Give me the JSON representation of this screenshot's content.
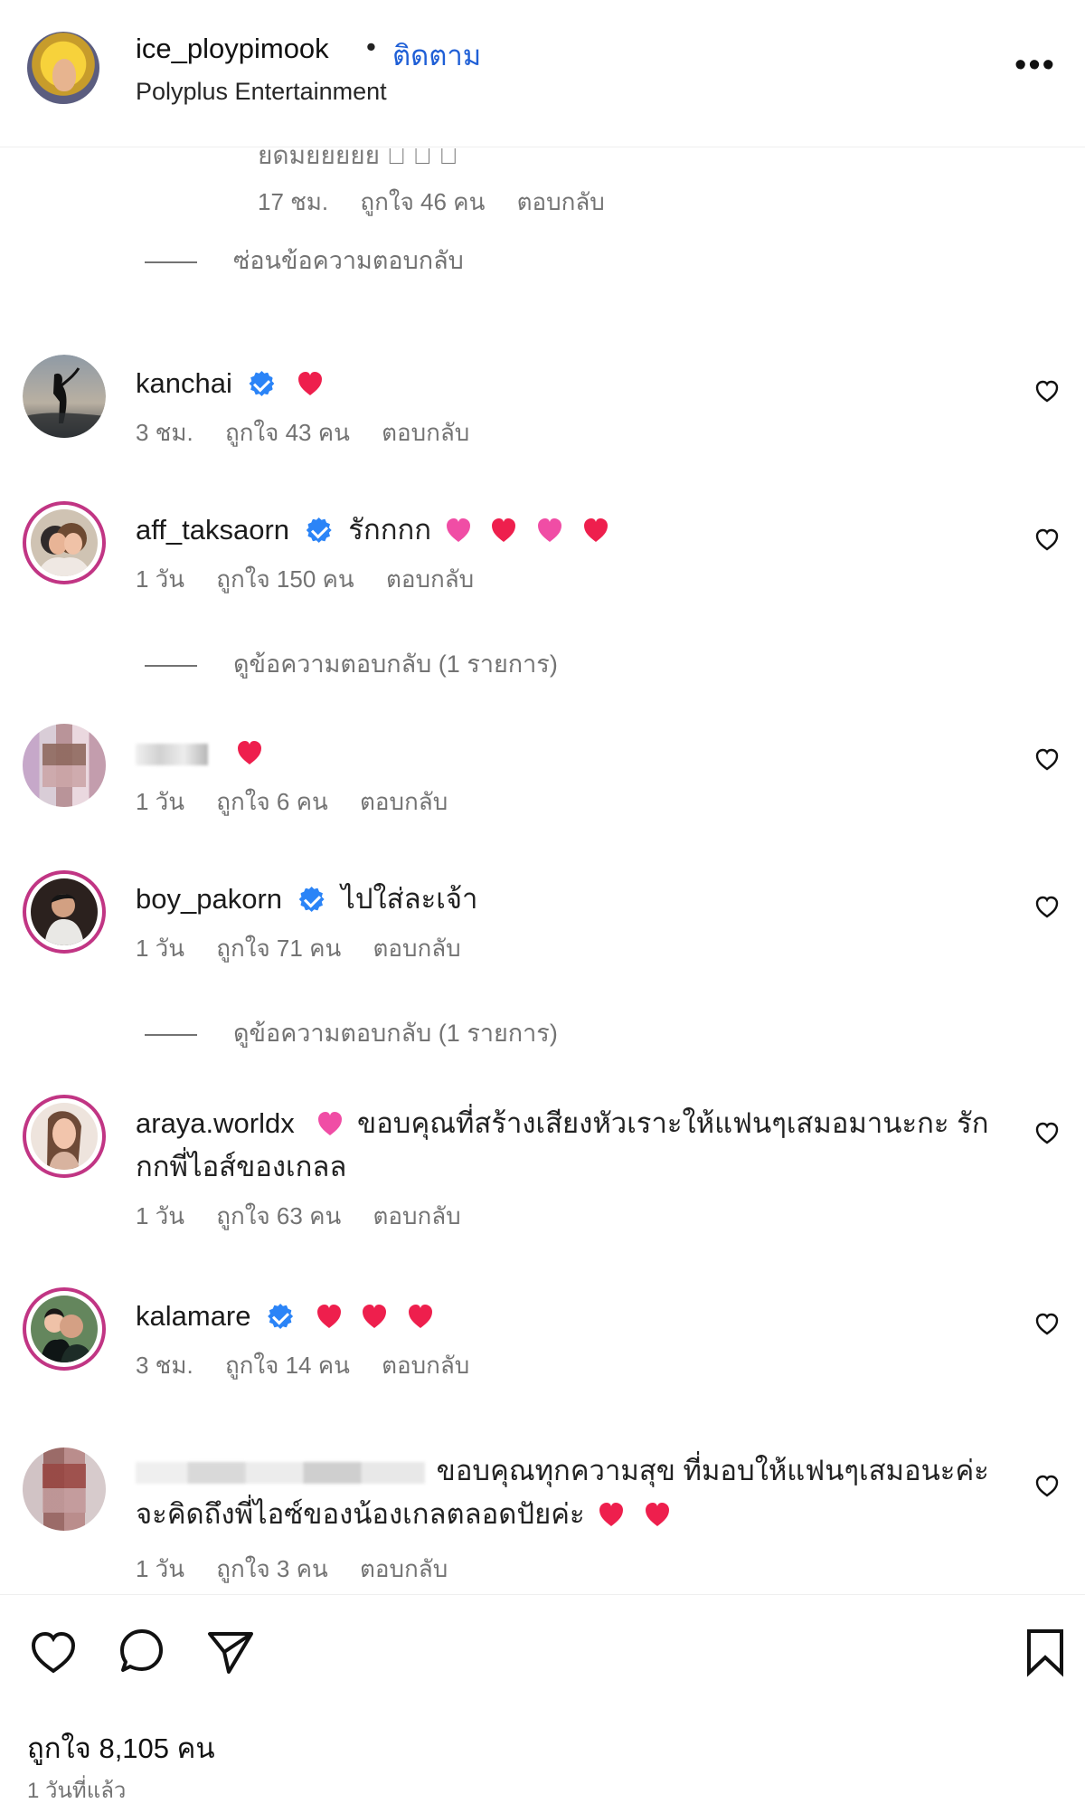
{
  "header": {
    "username": "ice_ploypimook",
    "separator": "•",
    "follow_label": "ติดตาม",
    "subtitle": "Polyplus Entertainment",
    "more_icon": "more-horizontal-icon"
  },
  "partial_comment": {
    "text": "ยดมยยยยย 🏻 🏻 🏻",
    "meta": {
      "time": "17 ชม.",
      "likes": "ถูกใจ 46 คน",
      "reply": "ตอบกลับ"
    },
    "toggle": "ซ่อนข้อความตอบกลับ"
  },
  "comments": [
    {
      "username": "kanchai",
      "verified": true,
      "text": "",
      "hearts": [
        "red"
      ],
      "meta": {
        "time": "3 ชม.",
        "likes": "ถูกใจ 43 คน",
        "reply": "ตอบกลับ"
      }
    },
    {
      "username": "aff_taksaorn",
      "verified": true,
      "text": "รักกกก",
      "hearts": [
        "pink",
        "red",
        "pink",
        "red"
      ],
      "meta": {
        "time": "1 วัน",
        "likes": "ถูกใจ 150 คน",
        "reply": "ตอบกลับ"
      },
      "reply_toggle": "ดูข้อความตอบกลับ (1 รายการ)"
    },
    {
      "username": "",
      "verified": false,
      "text": "",
      "hearts": [
        "red"
      ],
      "meta": {
        "time": "1 วัน",
        "likes": "ถูกใจ 6 คน",
        "reply": "ตอบกลับ"
      }
    },
    {
      "username": "boy_pakorn",
      "verified": true,
      "text": "ไปใส่ละเจ้า",
      "hearts": [],
      "meta": {
        "time": "1 วัน",
        "likes": "ถูกใจ 71 คน",
        "reply": "ตอบกลับ"
      },
      "reply_toggle": "ดูข้อความตอบกลับ (1 รายการ)"
    },
    {
      "username": "araya.worldx",
      "verified": false,
      "text": "ขอบคุณที่สร้างเสียงหัวเราะให้แฟนๆเสมอมานะกะ รักกกพี่ไอส์ของเกลล",
      "hearts": [
        "pink"
      ],
      "meta": {
        "time": "1 วัน",
        "likes": "ถูกใจ 63 คน",
        "reply": "ตอบกลับ"
      }
    },
    {
      "username": "kalamare",
      "verified": true,
      "text": "",
      "hearts": [
        "red",
        "red",
        "red"
      ],
      "meta": {
        "time": "3 ชม.",
        "likes": "ถูกใจ 14 คน",
        "reply": "ตอบกลับ"
      }
    },
    {
      "username": "",
      "verified": false,
      "text": "ขอบคุณทุกความสุข ที่มอบให้แฟนๆเสมอนะค่ะ จะคิดถึงพี่ไอซ์ของน้องเกลตลอดปัยค่ะ",
      "hearts": [
        "red",
        "red"
      ],
      "meta": {
        "time": "1 วัน",
        "likes": "ถูกใจ 3 คน",
        "reply": "ตอบกลับ"
      }
    }
  ],
  "footer": {
    "likes": "ถูกใจ 8,105 คน",
    "timestamp": "1 วันที่แล้ว",
    "icons": [
      "heart-icon",
      "comment-icon",
      "share-icon",
      "bookmark-icon"
    ]
  },
  "colors": {
    "verified": "#2b84f7",
    "red_heart": "#ee1f4d",
    "pink_heart": "#f04da5",
    "follow_link": "#1f5fd6"
  }
}
